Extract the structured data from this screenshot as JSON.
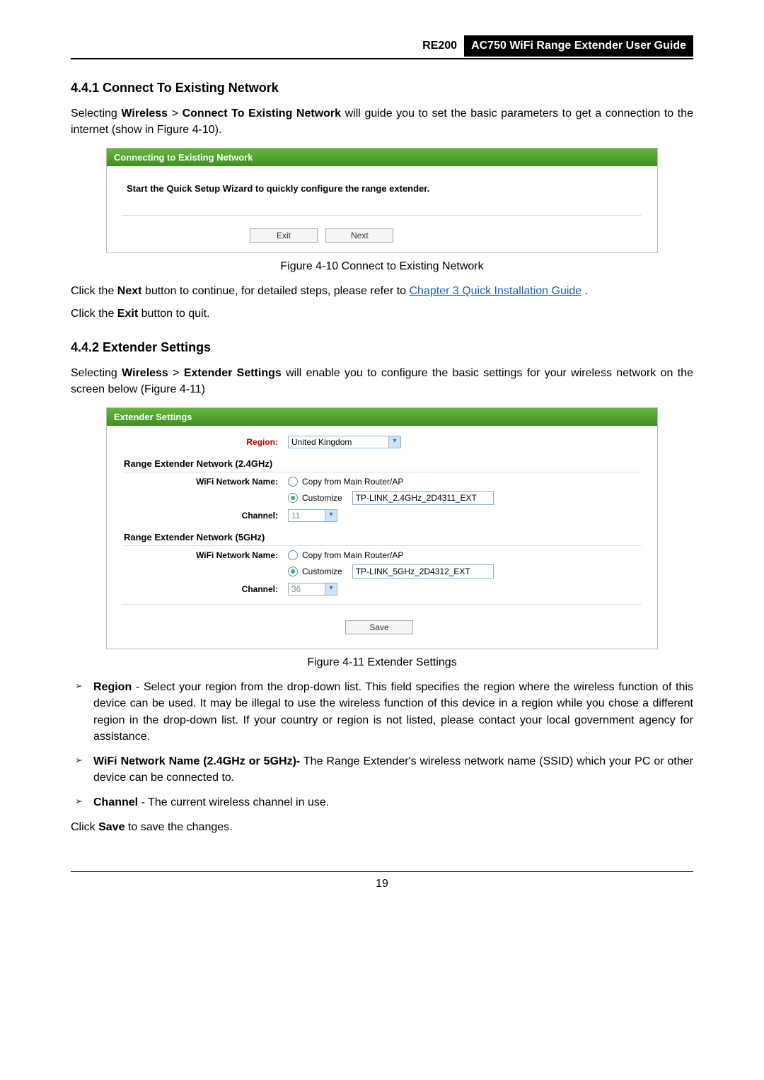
{
  "header": {
    "model": "RE200",
    "guide_title": "AC750 WiFi Range Extender User Guide"
  },
  "section1": {
    "heading": "4.4.1  Connect To Existing Network",
    "para1_pre": "Selecting ",
    "para1_b1": "Wireless",
    "para1_gt": " > ",
    "para1_b2": "Connect To Existing Network",
    "para1_post": " will guide you to set the basic parameters to get a connection to the internet (show in Figure 4-10).",
    "panel": {
      "title": "Connecting to Existing Network",
      "message": "Start the Quick Setup Wizard to quickly configure the range extender.",
      "exit_label": "Exit",
      "next_label": "Next"
    },
    "fig_caption": "Figure 4-10 Connect to Existing Network",
    "para2_pre": "Click the ",
    "para2_b1": "Next",
    "para2_mid": " button to continue, for detailed steps, please refer to ",
    "para2_link": "Chapter 3 Quick Installation Guide",
    "para2_post": " .",
    "para3_pre": "Click the ",
    "para3_b1": "Exit",
    "para3_post": " button to quit."
  },
  "section2": {
    "heading": "4.4.2  Extender Settings",
    "para1_pre": "Selecting ",
    "para1_b1": "Wireless",
    "para1_gt": " > ",
    "para1_b2": "Extender Settings",
    "para1_post": " will enable you to configure the basic settings for your wireless network on the screen below (Figure 4-11)",
    "panel": {
      "title": "Extender Settings",
      "region_label": "Region:",
      "region_value": "United Kingdom",
      "band24_heading": "Range Extender Network (2.4GHz)",
      "wifi_name_label": "WiFi Network Name:",
      "opt_copy": "Copy from Main Router/AP",
      "opt_customize": "Customize",
      "ssid_24": "TP-LINK_2.4GHz_2D4311_EXT",
      "channel_label": "Channel:",
      "channel_24": "11",
      "band5_heading": "Range Extender Network (5GHz)",
      "ssid_5": "TP-LINK_5GHz_2D4312_EXT",
      "channel_5": "36",
      "save_label": "Save"
    },
    "fig_caption": "Figure 4-11 Extender Settings",
    "bullets": {
      "b1_lead": "Region",
      "b1_text": " - Select your region from the drop-down list. This field specifies the region where the wireless function of this device can be used. It may be illegal to use the wireless function of this device in a region while you chose a different region in the drop-down list. If your country or region is not listed, please contact your local government agency for assistance.",
      "b2_lead": "WiFi Network Name (2.4GHz or 5GHz)-",
      "b2_text": " The Range Extender's wireless network name (SSID) which your PC or other device can be connected to.",
      "b3_lead": "Channel",
      "b3_text": " - The current wireless channel in use."
    },
    "closing_pre": "Click ",
    "closing_b": "Save",
    "closing_post": " to save the changes."
  },
  "page_number": "19"
}
